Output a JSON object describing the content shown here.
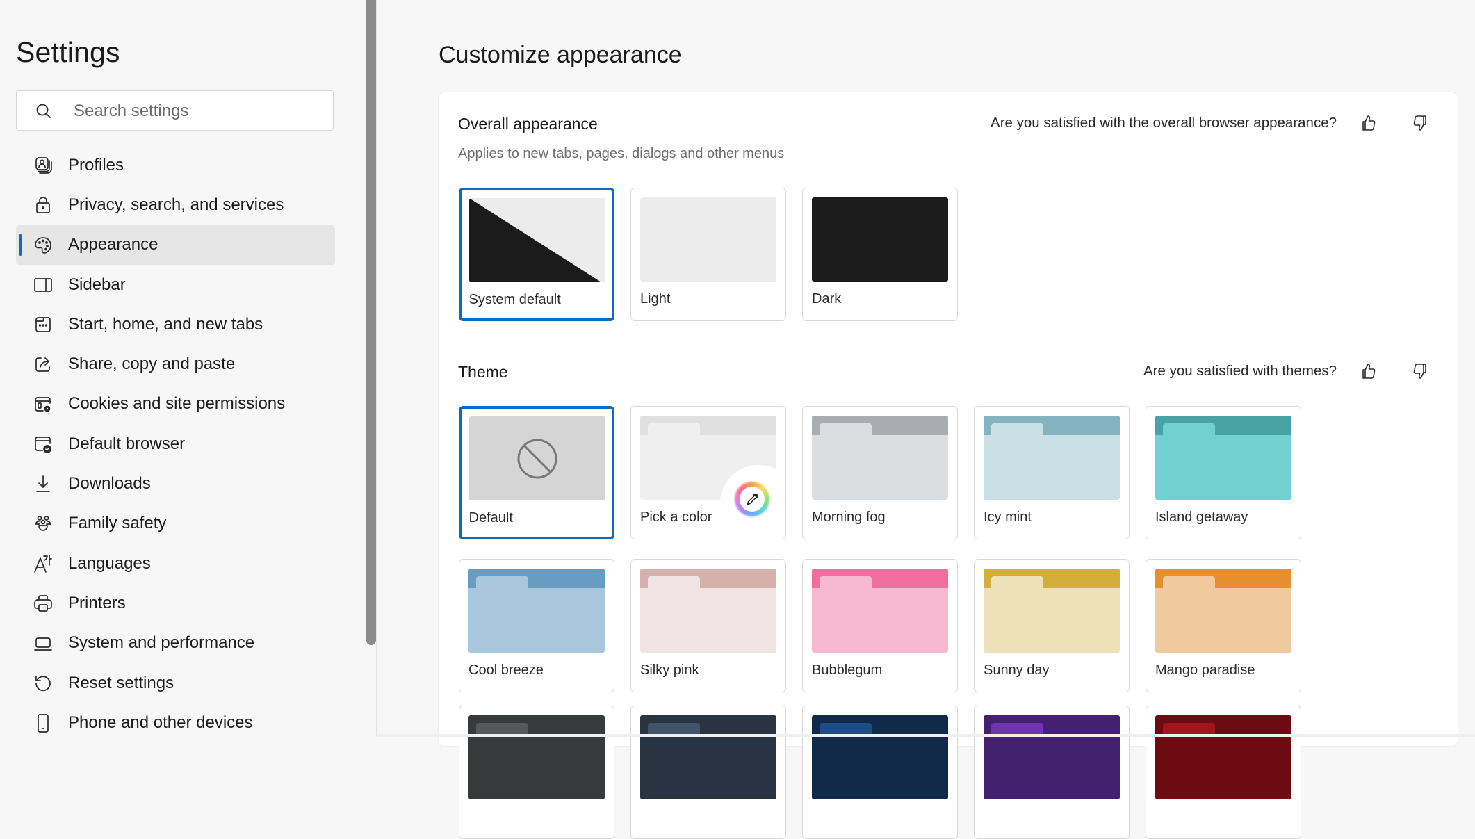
{
  "sidebar": {
    "title": "Settings",
    "search": {
      "placeholder": "Search settings",
      "value": ""
    },
    "items": [
      {
        "label": "Profiles",
        "icon": "profiles-icon"
      },
      {
        "label": "Privacy, search, and services",
        "icon": "lock-icon"
      },
      {
        "label": "Appearance",
        "icon": "palette-icon",
        "selected": true
      },
      {
        "label": "Sidebar",
        "icon": "sidebar-icon"
      },
      {
        "label": "Start, home, and new tabs",
        "icon": "new-tab-icon"
      },
      {
        "label": "Share, copy and paste",
        "icon": "share-icon"
      },
      {
        "label": "Cookies and site permissions",
        "icon": "cookies-permissions-icon"
      },
      {
        "label": "Default browser",
        "icon": "default-browser-icon"
      },
      {
        "label": "Downloads",
        "icon": "download-icon"
      },
      {
        "label": "Family safety",
        "icon": "family-icon"
      },
      {
        "label": "Languages",
        "icon": "languages-icon"
      },
      {
        "label": "Printers",
        "icon": "printer-icon"
      },
      {
        "label": "System and performance",
        "icon": "laptop-icon"
      },
      {
        "label": "Reset settings",
        "icon": "reset-icon"
      },
      {
        "label": "Phone and other devices",
        "icon": "phone-icon"
      }
    ]
  },
  "main": {
    "title": "Customize appearance",
    "overall": {
      "heading": "Overall appearance",
      "subtitle": "Applies to new tabs, pages, dialogs and other menus",
      "feedback_question": "Are you satisfied with the overall browser appearance?",
      "options": [
        {
          "label": "System default",
          "selected": true
        },
        {
          "label": "Light",
          "selected": false
        },
        {
          "label": "Dark",
          "selected": false
        }
      ]
    },
    "theme": {
      "heading": "Theme",
      "feedback_question": "Are you satisfied with themes?",
      "options": [
        {
          "label": "Default",
          "selected": true
        },
        {
          "label": "Pick a color"
        },
        {
          "label": "Morning fog",
          "top": "#a9adb1",
          "tab": "#dcdde0",
          "body": "#dcdde0"
        },
        {
          "label": "Icy mint",
          "top": "#84b4bf",
          "tab": "#cbe0e6",
          "body": "#cbe0e6"
        },
        {
          "label": "Island getaway",
          "top": "#47a3a6",
          "tab": "#72d0d2",
          "body": "#72d0d2"
        },
        {
          "label": "Cool breeze",
          "top": "#689dc1",
          "tab": "#a8c6dc",
          "body": "#a8c6dc"
        },
        {
          "label": "Silky pink",
          "top": "#d6b0aa",
          "tab": "#f1e2e3",
          "body": "#f1e2e3"
        },
        {
          "label": "Bubblegum",
          "top": "#f06f9d",
          "tab": "#f7b9d0",
          "body": "#f7b9d0"
        },
        {
          "label": "Sunny day",
          "top": "#d3ae3c",
          "tab": "#ede1ba",
          "body": "#ede1ba"
        },
        {
          "label": "Mango paradise",
          "top": "#e58f30",
          "tab": "#f0c99e",
          "body": "#f0c99e"
        },
        {
          "label": "",
          "top": "#38393b",
          "tab": "#57585a",
          "body": "#38393b"
        },
        {
          "label": "",
          "top": "#283442",
          "tab": "#43536a",
          "body": "#283442"
        },
        {
          "label": "",
          "top": "#112a4a",
          "tab": "#1d4d82",
          "body": "#112a4a"
        },
        {
          "label": "",
          "top": "#45206f",
          "tab": "#6e34b1",
          "body": "#45206f"
        },
        {
          "label": "",
          "top": "#6c0c12",
          "tab": "#a1151e",
          "body": "#6c0c12"
        }
      ]
    }
  },
  "colors": {
    "accent": "#0f6cbd",
    "page_bg": "#f7f7f7",
    "card_bg": "#ffffff",
    "selected_nav_bg": "#e6e6e6"
  }
}
